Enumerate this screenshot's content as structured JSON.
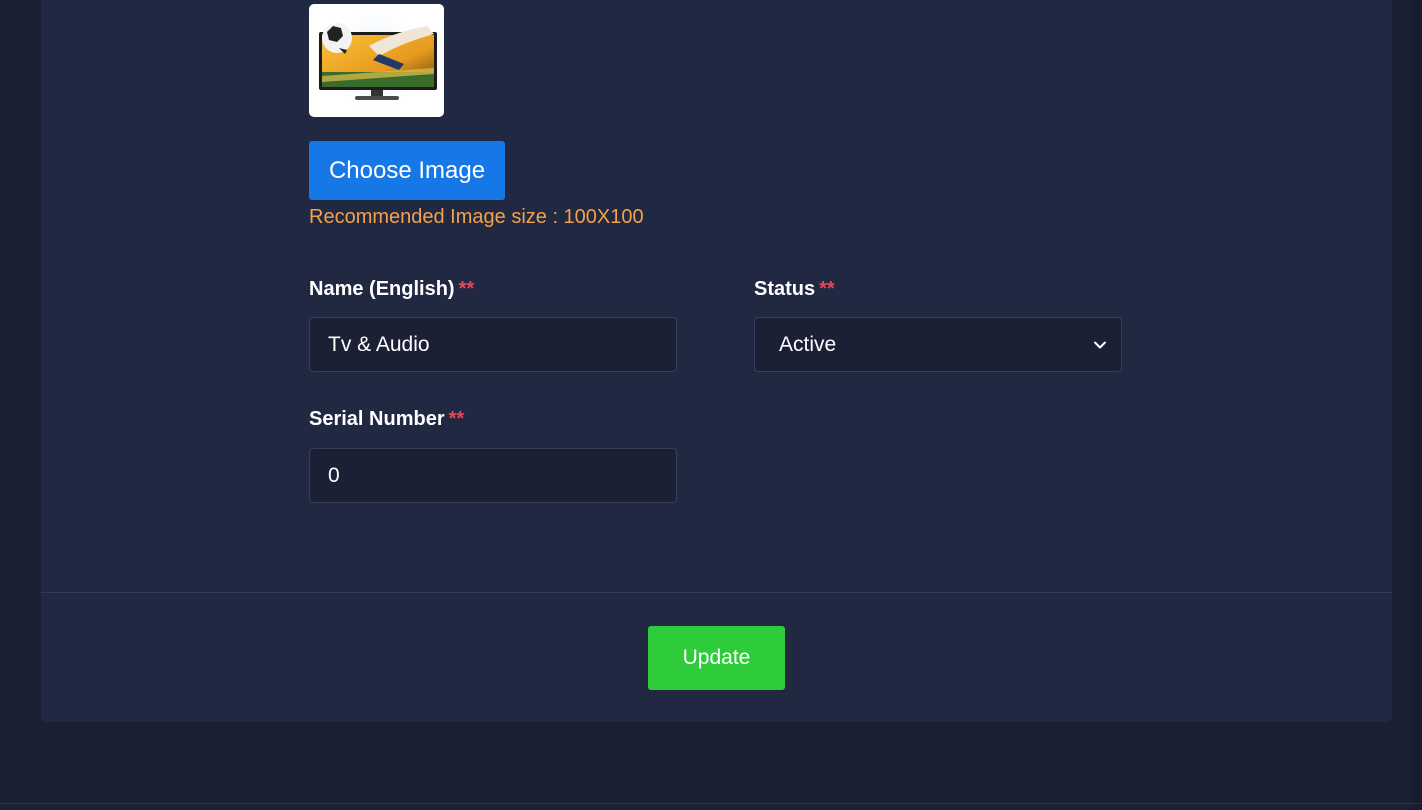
{
  "image_upload": {
    "thumbnail_icon": "tv-with-soccer-player-image",
    "choose_label": "Choose Image",
    "hint": "Recommended Image size : 100X100"
  },
  "form": {
    "name": {
      "label": "Name (English)",
      "required_mark": "**",
      "value": "Tv & Audio"
    },
    "status": {
      "label": "Status",
      "required_mark": "**",
      "selected": "Active",
      "icon": "chevron-down-icon"
    },
    "serial": {
      "label": "Serial Number",
      "required_mark": "**",
      "value": "0"
    }
  },
  "footer": {
    "update_label": "Update"
  },
  "colors": {
    "primary_button": "#1677e6",
    "success_button": "#2ecc3a",
    "hint_text": "#f5a14a",
    "required_mark": "#e8475a",
    "card_background": "#212842"
  }
}
